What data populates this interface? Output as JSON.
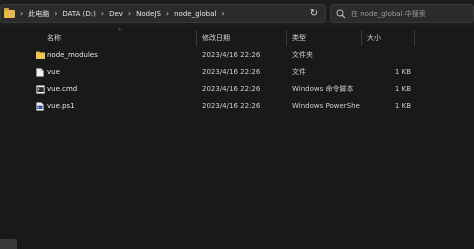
{
  "address": {
    "crumbs": [
      "此电脑",
      "DATA (D:)",
      "Dev",
      "NodeJS",
      "node_global"
    ],
    "separator": "›",
    "dropdown_glyph": "⌄",
    "refresh_glyph": "↻",
    "folder_color": "#e8b84a"
  },
  "search": {
    "placeholder": "在 node_global 中搜索"
  },
  "columns": {
    "name": "名称",
    "date": "修改日期",
    "type": "类型",
    "size": "大小",
    "sort_glyph": "⌃"
  },
  "files": [
    {
      "name": "node_modules",
      "date": "2023/4/16 22:26",
      "type": "文件夹",
      "size": "",
      "icon": "folder-icon"
    },
    {
      "name": "vue",
      "date": "2023/4/16 22:26",
      "type": "文件",
      "size": "1 KB",
      "icon": "file-icon"
    },
    {
      "name": "vue.cmd",
      "date": "2023/4/16 22:26",
      "type": "Windows 命令脚本",
      "size": "1 KB",
      "icon": "cmd-file-icon"
    },
    {
      "name": "vue.ps1",
      "date": "2023/4/16 22:26",
      "type": "Windows PowerShell ...",
      "size": "1 KB",
      "icon": "powershell-file-icon"
    }
  ]
}
